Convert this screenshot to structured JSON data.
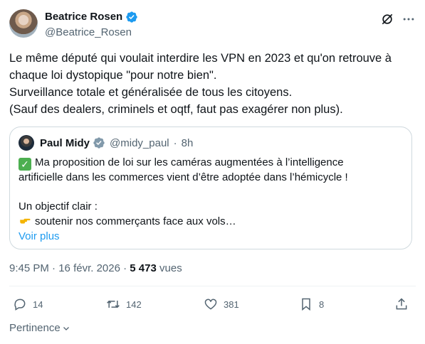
{
  "author": {
    "name": "Beatrice Rosen",
    "handle": "@Beatrice_Rosen",
    "verified_icon": "verified-badge-icon"
  },
  "tweet": {
    "lines": [
      "Le même député qui voulait interdire les VPN en 2023 et qu'on retrouve à",
      "chaque loi dystopique \"pour notre bien\".",
      "Surveillance totale et généralisée de tous les citoyens.",
      "(Sauf des dealers, criminels et oqtf, faut pas exagérer non plus)."
    ]
  },
  "quote": {
    "name": "Paul Midy",
    "handle": "@midy_paul",
    "separator": "·",
    "time": "8h",
    "line1": "Ma proposition de loi sur les caméras augmentées à l’intelligence",
    "line2": "artificielle dans les commerces vient d’être adoptée dans l’hémicycle !",
    "line3": "Un objectif clair :",
    "line4": "soutenir nos commerçants face aux vols…",
    "see_more": "Voir plus"
  },
  "meta": {
    "time": "9:45 PM",
    "separator": "·",
    "date": "16 févr. 2026",
    "separator2": "·",
    "views": "5 473",
    "views_label": "vues"
  },
  "actions": {
    "replies": "14",
    "reposts": "142",
    "likes": "381",
    "bookmarks": "8"
  },
  "sort": {
    "label": "Pertinence"
  },
  "colors": {
    "accent": "#1d9bf0",
    "text": "#0f1419",
    "muted": "#536471",
    "border": "#cfd9de"
  }
}
